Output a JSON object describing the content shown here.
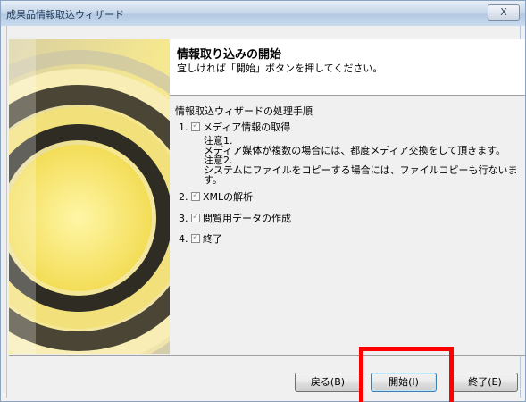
{
  "window": {
    "title": "成果品情報取込ウィザード",
    "close_label": "X"
  },
  "header": {
    "title": "情報取り込みの開始",
    "subtitle": "宜しければ「開始」ボタンを押してください。"
  },
  "procedure": {
    "title": "情報取込ウィザードの処理手順",
    "steps": [
      {
        "number": "1.",
        "label": "メディア情報の取得",
        "checked": true
      },
      {
        "number": "2.",
        "label": "XMLの解析",
        "checked": true
      },
      {
        "number": "3.",
        "label": "閲覧用データの作成",
        "checked": true
      },
      {
        "number": "4.",
        "label": "終了",
        "checked": true
      }
    ],
    "notes": [
      "注意1.",
      "メディア媒体が複数の場合には、都度メディア交換をして頂きます。",
      "注意2.",
      "システムにファイルをコピーする場合には、ファイルコピーも行ないま",
      "す。"
    ]
  },
  "buttons": {
    "back": "戻る(B)",
    "start": "開始(I)",
    "finish": "終了(E)"
  },
  "colors": {
    "highlight": "#ff0000",
    "side_image_gold": "#f4e49a",
    "side_image_dark": "#3a3a2e"
  }
}
